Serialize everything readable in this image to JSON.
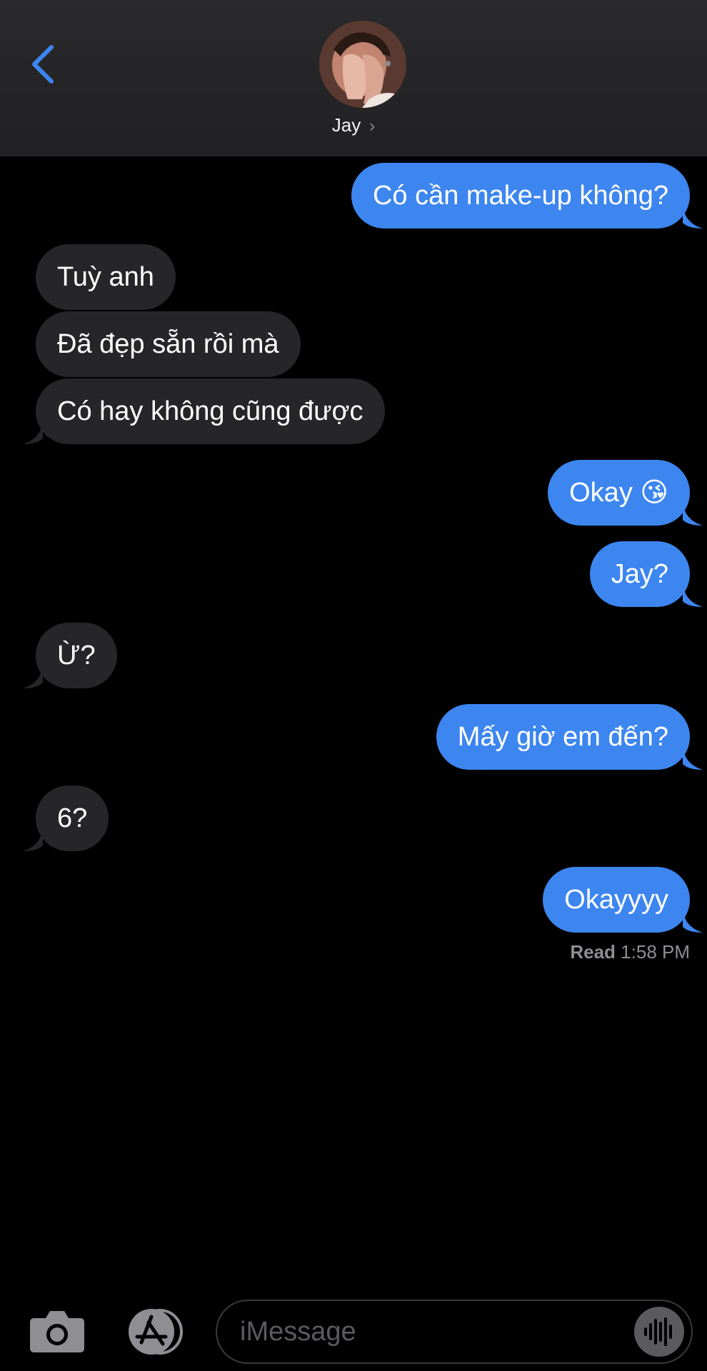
{
  "header": {
    "contact_name": "Jay",
    "chevron": "›"
  },
  "messages": [
    {
      "side": "sent",
      "text": "Có cần make-up không?"
    },
    {
      "side": "recv",
      "text": "Tuỳ anh"
    },
    {
      "side": "recv",
      "text": "Đã đẹp sẵn rồi mà"
    },
    {
      "side": "recv",
      "text": "Có hay không cũng được"
    },
    {
      "side": "sent",
      "text": "Okay 😘"
    },
    {
      "side": "sent",
      "text": "Jay?"
    },
    {
      "side": "recv",
      "text": "Ừ?"
    },
    {
      "side": "sent",
      "text": "Mấy giờ em đến?"
    },
    {
      "side": "recv",
      "text": "6?"
    },
    {
      "side": "sent",
      "text": "Okayyyy"
    }
  ],
  "read_receipt": {
    "label": "Read",
    "time": "1:58 PM"
  },
  "composer": {
    "placeholder": "iMessage",
    "icons": [
      "camera-icon",
      "app-store-icon",
      "audio-waveform-icon"
    ]
  },
  "colors": {
    "sent_bubble": "#3d86f0",
    "recv_bubble": "#262628",
    "accent": "#3d86f0",
    "background": "#000000"
  }
}
